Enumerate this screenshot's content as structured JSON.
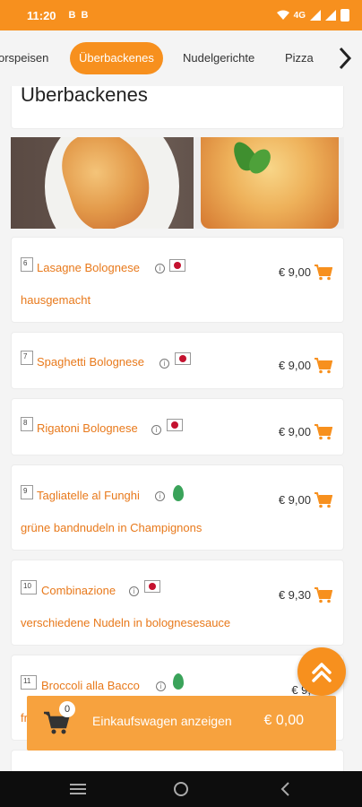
{
  "status_bar": {
    "time": "11:20",
    "left_icons": [
      "B",
      "B"
    ],
    "network": "4G"
  },
  "categories": [
    {
      "label": "orspeisen"
    },
    {
      "label": "Überbackenes"
    },
    {
      "label": "Nudelgerichte"
    },
    {
      "label": "Pizza"
    }
  ],
  "active_category": "Überbackenes",
  "section": {
    "title": "Überbackenes"
  },
  "items": [
    {
      "number": "6",
      "name": "Lasagne Bolognese",
      "description": "hausgemacht",
      "price": "€ 9,00",
      "badge": "flag-icon"
    },
    {
      "number": "7",
      "name": "Spaghetti Bolognese",
      "description": "",
      "price": "€ 9,00",
      "badge": "flag-icon"
    },
    {
      "number": "8",
      "name": "Rigatoni Bolognese",
      "description": "",
      "price": "€ 9,00",
      "badge": "flag-icon"
    },
    {
      "number": "9",
      "name": "Tagliatelle al Funghi",
      "description": "grüne bandnudeln in Champignons",
      "price": "€ 9,00",
      "badge": "vegetarian-leaf-icon"
    },
    {
      "number": "10",
      "name": "Combinazione",
      "description": "verschiedene Nudeln in bolognesesauce",
      "price": "€ 9,30",
      "badge": "flag-icon"
    },
    {
      "number": "11",
      "name": "Broccoli alla Bacco",
      "description": "fr",
      "price": "€ 9,",
      "badge": "vegetarian-leaf-icon"
    }
  ],
  "cart": {
    "count": "0",
    "label": "Einkaufswagen anzeigen",
    "total": "€ 0,00"
  },
  "colors": {
    "accent": "#f7901e",
    "item_text": "#e8791b",
    "cart_bar": "#f7a23e",
    "nav_bar": "#0d0d0d"
  }
}
